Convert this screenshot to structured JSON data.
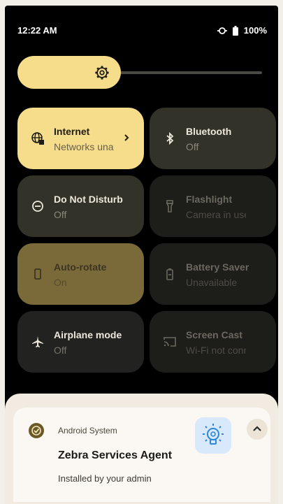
{
  "status_bar": {
    "time": "12:22 AM",
    "battery_text": "100%"
  },
  "quick_settings": {
    "tiles": [
      {
        "title": "Internet",
        "subtitle": "Networks unavailable",
        "state": "on",
        "icon": "internet-icon"
      },
      {
        "title": "Bluetooth",
        "subtitle": "Off",
        "state": "off",
        "icon": "bluetooth-icon"
      },
      {
        "title": "Do Not Disturb",
        "subtitle": "Off",
        "state": "off",
        "icon": "do-not-disturb-icon"
      },
      {
        "title": "Flashlight",
        "subtitle": "Camera in use",
        "state": "unavailable",
        "icon": "flashlight-icon"
      },
      {
        "title": "Auto-rotate",
        "subtitle": "On",
        "state": "on-dim",
        "icon": "auto-rotate-icon"
      },
      {
        "title": "Battery Saver",
        "subtitle": "Unavailable",
        "state": "unavailable",
        "icon": "battery-saver-icon"
      },
      {
        "title": "Airplane mode",
        "subtitle": "Off",
        "state": "off",
        "icon": "airplane-icon"
      },
      {
        "title": "Screen Cast",
        "subtitle": "Wi-Fi not connected",
        "state": "unavailable",
        "icon": "screen-cast-icon"
      }
    ]
  },
  "notification": {
    "app_name": "Android System",
    "title": "Zebra Services Agent",
    "text": "Installed by your admin"
  },
  "colors": {
    "tile_on": "#f6dd8b",
    "tile_off": "#333229",
    "tile_dim": "#1d1d19",
    "accent": "#6b5a26"
  }
}
